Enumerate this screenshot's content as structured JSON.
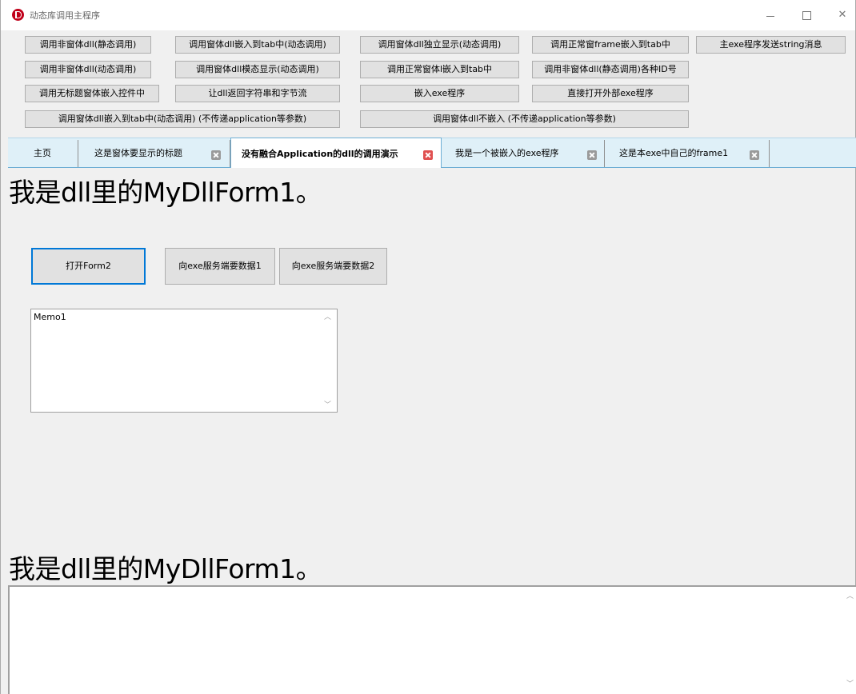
{
  "window": {
    "title": "动态库调用主程序",
    "minimize": "",
    "maximize": "",
    "close": "✕"
  },
  "toolbar": {
    "row1": [
      "调用非窗体dll(静态调用)",
      "调用窗体dll嵌入到tab中(动态调用)",
      "调用窗体dll独立显示(动态调用)",
      "调用正常窗frame嵌入到tab中",
      "主exe程序发送string消息"
    ],
    "row2": [
      "调用非窗体dll(动态调用)",
      "调用窗体dll模态显示(动态调用)",
      "调用正常窗体l嵌入到tab中",
      "调用非窗体dll(静态调用)各种ID号"
    ],
    "row3": [
      "调用无标题窗体嵌入控件中",
      "让dll返回字符串和字节流",
      "嵌入exe程序",
      "直接打开外部exe程序"
    ],
    "row4": [
      "调用窗体dll嵌入到tab中(动态调用) (不传递application等参数)",
      "调用窗体dll不嵌入 (不传递application等参数)"
    ]
  },
  "tabs": [
    {
      "label": "主页",
      "closable": false,
      "active": false
    },
    {
      "label": "这是窗体要显示的标题",
      "closable": true,
      "active": false
    },
    {
      "label": "没有融合Application的dll的调用演示",
      "closable": true,
      "active": true
    },
    {
      "label": "我是一个被嵌入的exe程序",
      "closable": true,
      "active": false
    },
    {
      "label": "这是本exe中自己的frame1",
      "closable": true,
      "active": false
    }
  ],
  "content": {
    "heading_top": "我是dll里的MyDllForm1。",
    "open_form2": "打开Form2",
    "request_data1": "向exe服务端要数据1",
    "request_data2": "向exe服务端要数据2",
    "memo_text": "Memo1",
    "heading_bottom": "我是dll里的MyDllForm1。"
  },
  "colors": {
    "tabstrip_bg": "#dff0f8",
    "focus_border": "#0078d7",
    "app_icon": "#c0001a"
  }
}
